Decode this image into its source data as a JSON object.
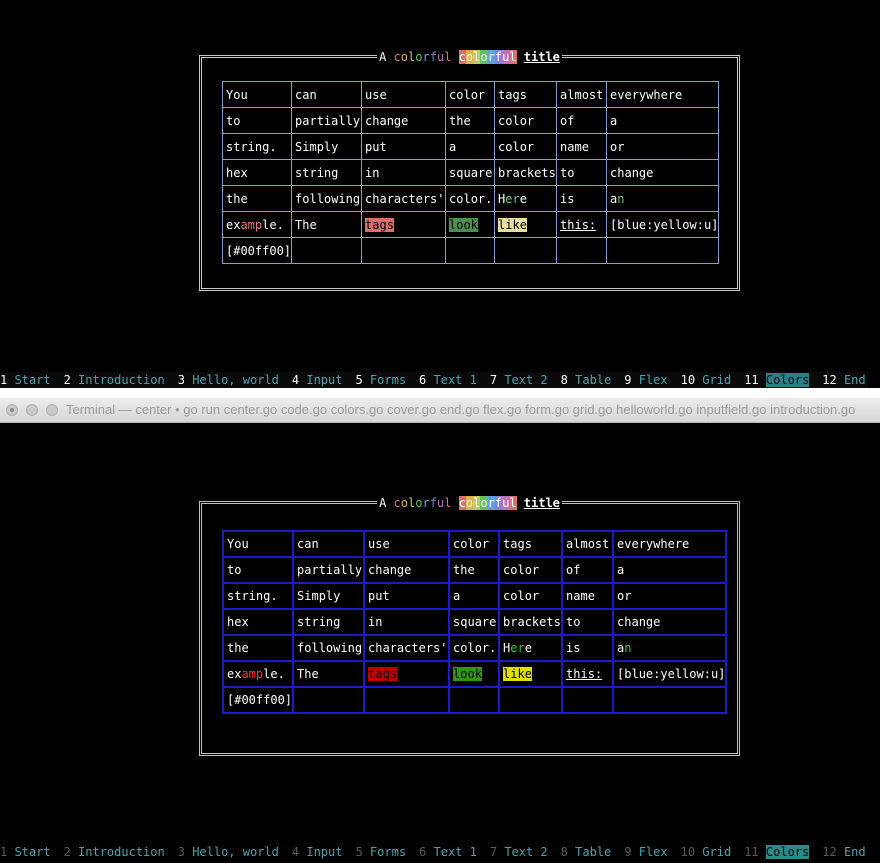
{
  "terminal": {
    "window_title": "Terminal — center • go run center.go code.go colors.go cover.go end.go flex.go form.go grid.go helloworld.go inputfield.go introduction.go"
  },
  "title_parts": [
    {
      "text": "A ",
      "color": "#ffffff"
    },
    {
      "text": "c",
      "color": "#e06c6c"
    },
    {
      "text": "o",
      "color": "#e0b050"
    },
    {
      "text": "l",
      "color": "#c8c860"
    },
    {
      "text": "o",
      "color": "#60c060"
    },
    {
      "text": "r",
      "color": "#60a0e0"
    },
    {
      "text": "f",
      "color": "#8080e0"
    },
    {
      "text": "u",
      "color": "#c070c0"
    },
    {
      "text": "l",
      "color": "#e07070"
    },
    {
      "text": " ",
      "color": "#ffffff"
    },
    {
      "text": "c",
      "color": "#e06c6c",
      "bg": true
    },
    {
      "text": "o",
      "color": "#e0b050",
      "bg": true
    },
    {
      "text": "l",
      "color": "#c8c860",
      "bg": true
    },
    {
      "text": "o",
      "color": "#60c060",
      "bg": true
    },
    {
      "text": "r",
      "color": "#60a0e0",
      "bg": true
    },
    {
      "text": "f",
      "color": "#8080e0",
      "bg": true
    },
    {
      "text": "u",
      "color": "#c070c0",
      "bg": true
    },
    {
      "text": "l",
      "color": "#e07070",
      "bg": true
    },
    {
      "text": " ",
      "color": "#ffffff"
    },
    {
      "text": "title",
      "color": "#ffffff",
      "underline": true
    }
  ],
  "table": {
    "rows": [
      [
        "You",
        "can",
        "use",
        "color",
        "tags",
        "almost",
        "everywhere"
      ],
      [
        "to",
        "partially",
        "change",
        "the",
        "color",
        "of",
        "a"
      ],
      [
        "string.",
        "Simply",
        "put",
        "a",
        "color",
        "name",
        "or"
      ],
      [
        "hex",
        "string",
        "in",
        "square",
        "brackets",
        "to",
        "change"
      ],
      [
        "the",
        "following",
        "characters'",
        "color.",
        "Here",
        "is",
        "an"
      ],
      [
        "example.",
        "The",
        "tags",
        "look",
        "like",
        "this:",
        "[blue:yellow:u]"
      ],
      [
        "[#00ff00]",
        "",
        "",
        "",
        "",
        "",
        ""
      ]
    ]
  },
  "statusbar": {
    "tabs": [
      {
        "num": "1",
        "label": "Start"
      },
      {
        "num": "2",
        "label": "Introduction"
      },
      {
        "num": "3",
        "label": "Hello, world"
      },
      {
        "num": "4",
        "label": "Input"
      },
      {
        "num": "5",
        "label": "Forms"
      },
      {
        "num": "6",
        "label": "Text 1"
      },
      {
        "num": "7",
        "label": "Text 2"
      },
      {
        "num": "8",
        "label": "Table"
      },
      {
        "num": "9",
        "label": "Flex"
      },
      {
        "num": "10",
        "label": "Grid"
      },
      {
        "num": "11",
        "label": "Colors",
        "active": true
      },
      {
        "num": "12",
        "label": "End"
      }
    ]
  },
  "colors": {
    "pane1_grid": "#8a9ad6",
    "pane2_grid": "#1b1bc8",
    "status_text": "#4aa3b0",
    "status_active_bg": "#2b7f86"
  }
}
